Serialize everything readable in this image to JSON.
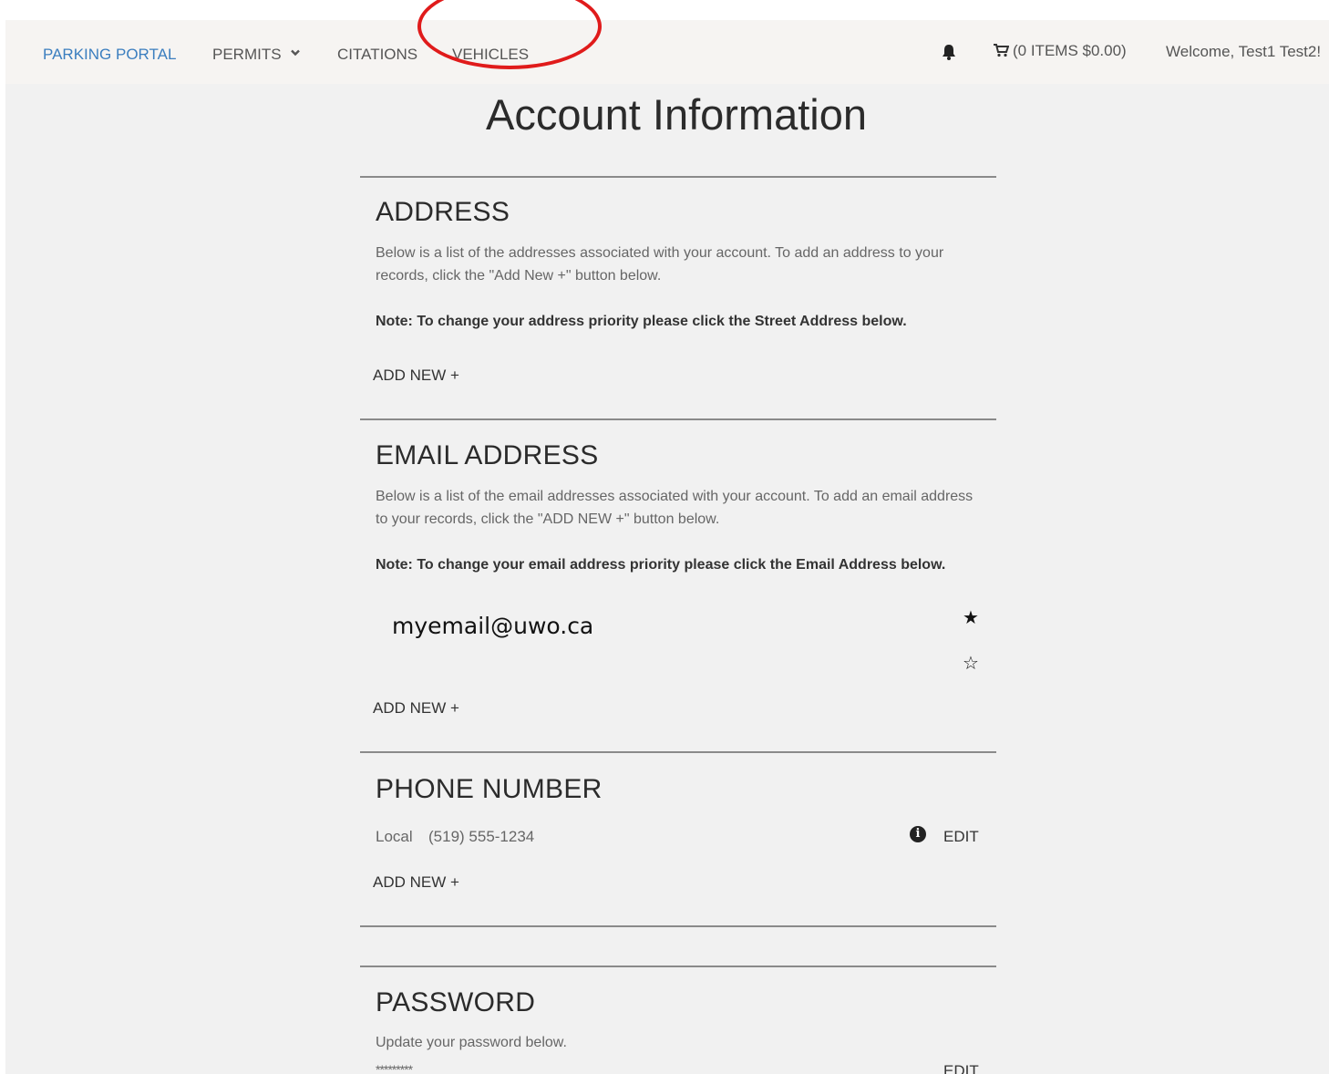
{
  "nav": {
    "brand": "PARKING PORTAL",
    "permits": "PERMITS",
    "citations": "CITATIONS",
    "vehicles": "VEHICLES",
    "cart": "(0 ITEMS $0.00)",
    "welcome": "Welcome, Test1 Test2!"
  },
  "page": {
    "title": "Account Information"
  },
  "address": {
    "title": "ADDRESS",
    "description": "Below is a list of the addresses associated with your account. To add an address to your records, click the \"Add New +\" button below.",
    "note": "Note: To change your address priority please click the Street Address below.",
    "add_new": "ADD NEW +"
  },
  "email": {
    "title": "EMAIL ADDRESS",
    "description": "Below is a list of the email addresses associated with your account. To add an email address to your records, click the \"ADD NEW +\" button below.",
    "note": "Note: To change your email address priority please click the Email Address below.",
    "value": "myemail@uwo.ca",
    "star_filled": "★",
    "star_empty": "☆",
    "add_new": "ADD NEW +"
  },
  "phone": {
    "title": "PHONE NUMBER",
    "type": "Local",
    "value": "(519) 555-1234",
    "info": "i",
    "edit": "EDIT",
    "add_new": "ADD NEW +"
  },
  "password": {
    "title": "PASSWORD",
    "description": "Update your password below.",
    "mask": "*********",
    "edit": "EDIT"
  },
  "annotation": {
    "color": "#e01b1b"
  }
}
